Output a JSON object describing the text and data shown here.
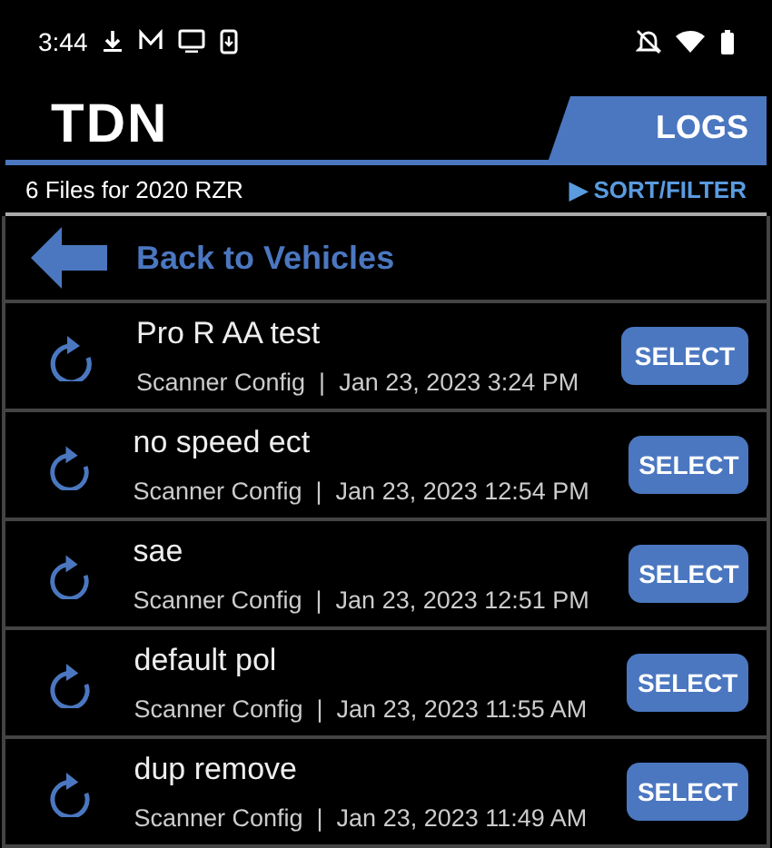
{
  "status_bar": {
    "time": "3:44"
  },
  "header": {
    "logo": "TDN",
    "tab": "LOGS"
  },
  "subheader": {
    "count": "6 Files for 2020 RZR",
    "sort_arrow": "▶",
    "sort": "SORT/FILTER"
  },
  "back": {
    "label": "Back to Vehicles"
  },
  "files": [
    {
      "name": "Pro R AA test",
      "meta": "Scanner Config  |  Jan 23, 2023 3:24 PM",
      "button": "SELECT"
    },
    {
      "name": "no speed ect",
      "meta": "Scanner Config  |  Jan 23, 2023 12:54 PM",
      "button": "SELECT"
    },
    {
      "name": "sae",
      "meta": "Scanner Config  |  Jan 23, 2023 12:51 PM",
      "button": "SELECT"
    },
    {
      "name": "default pol",
      "meta": "Scanner Config  |  Jan 23, 2023 11:55 AM",
      "button": "SELECT"
    },
    {
      "name": "dup remove",
      "meta": "Scanner Config  |  Jan 23, 2023 11:49 AM",
      "button": "SELECT"
    }
  ]
}
